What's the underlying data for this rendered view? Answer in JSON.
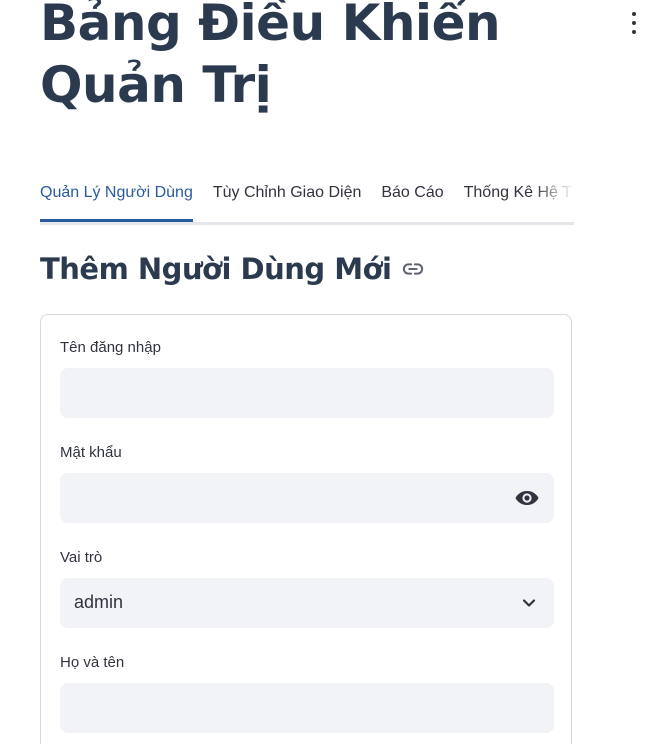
{
  "header": {
    "title_line1": "Bảng Điều Khiển",
    "title_line2": "Quản Trị"
  },
  "tabs": [
    {
      "label": "Quản Lý Người Dùng",
      "active": true
    },
    {
      "label": "Tùy Chỉnh Giao Diện",
      "active": false
    },
    {
      "label": "Báo Cáo",
      "active": false
    },
    {
      "label": "Thống Kê Hệ Thống",
      "active": false
    }
  ],
  "section": {
    "title": "Thêm Người Dùng Mới"
  },
  "form": {
    "username": {
      "label": "Tên đăng nhập",
      "value": ""
    },
    "password": {
      "label": "Mật khẩu",
      "value": ""
    },
    "role": {
      "label": "Vai trò",
      "value": "admin"
    },
    "fullname": {
      "label": "Họ và tên",
      "value": ""
    }
  },
  "icons": {
    "menu": "kebab-menu-icon",
    "link": "link-icon",
    "password_toggle": "eye-icon",
    "select": "chevron-down-icon"
  },
  "colors": {
    "accent": "#2b5a9e",
    "heading": "#2b3a4e",
    "input_bg": "#f2f3f6",
    "border": "#d6d8de"
  }
}
